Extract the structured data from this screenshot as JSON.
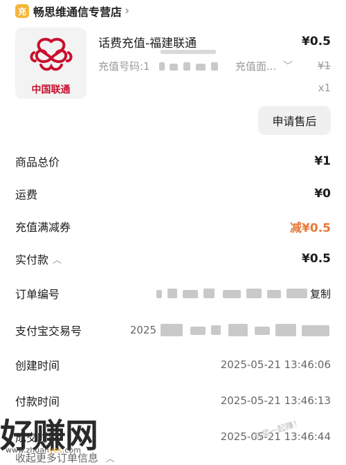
{
  "shop": {
    "name": "畅思维通信专营店",
    "badge": "充"
  },
  "product": {
    "title": "话费充值-福建联通",
    "price": "¥0.5",
    "recharge_no_label": "充值号码:1",
    "spec_label": "充值面...",
    "original_price": "¥1",
    "quantity": "x1",
    "logo_text": "中国联通"
  },
  "buttons": {
    "after_sale": "申请售后"
  },
  "summary": [
    {
      "label": "商品总价",
      "value": "¥1"
    },
    {
      "label": "运费",
      "value": "¥0"
    },
    {
      "label": "充值满减券",
      "value": "减¥0.5"
    },
    {
      "label": "实付款",
      "value": "¥0.5"
    }
  ],
  "order": {
    "order_no_label": "订单编号",
    "copy_label": "复制",
    "alipay_no_label": "支付宝交易号",
    "alipay_no_prefix": "2025",
    "created_label": "创建时间",
    "created_value": "2025-05-21 13:46:06",
    "paid_label": "付款时间",
    "paid_value": "2025-05-21 13:46:13",
    "deal_label": "成交时间",
    "deal_value": "2025-05-21 13:46:44"
  },
  "more_toggle": "收起更多订单信息",
  "watermark": {
    "text": "好赚网",
    "url_a": "www.zhuan",
    "url_b": "yes",
    "url_c": ".com",
    "faint": "有奖一起赚！"
  },
  "colors": {
    "accent": "#e8793a",
    "brand_red": "#c8102e",
    "badge": "#f5b63a"
  }
}
